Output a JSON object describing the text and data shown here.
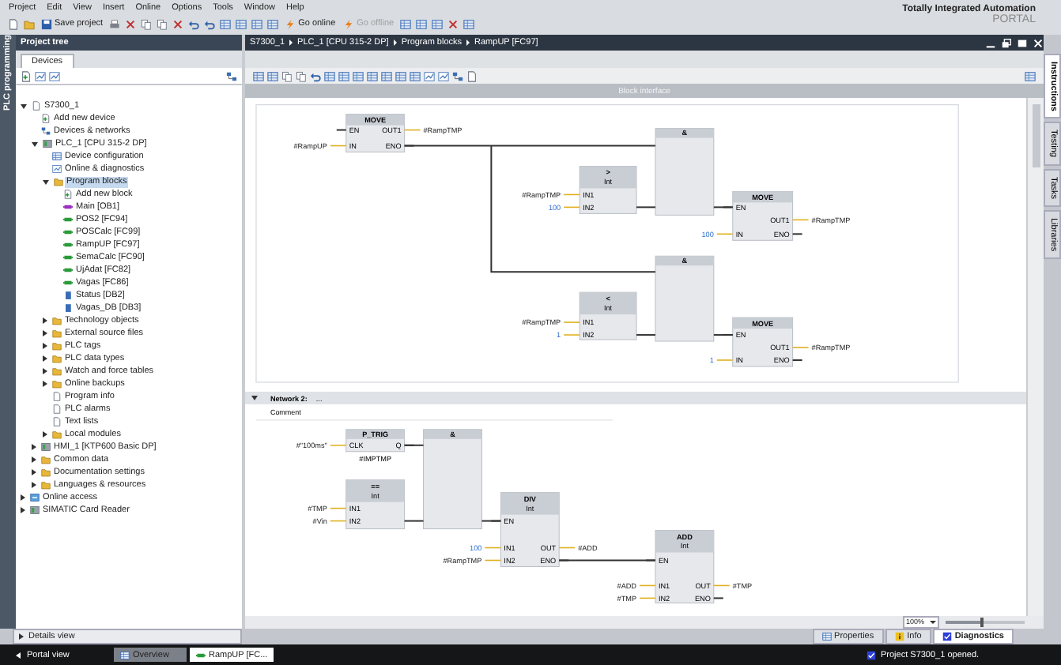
{
  "menu": [
    "Project",
    "Edit",
    "View",
    "Insert",
    "Online",
    "Options",
    "Tools",
    "Window",
    "Help"
  ],
  "brand": {
    "line_1": "Totally Integrated Automation",
    "line_2": "PORTAL"
  },
  "toolbar": {
    "save_label": "Save project",
    "online_label": "Go online",
    "offline": {
      "label": "Go offline",
      "disabled": true
    }
  },
  "left_strip": "PLC programming",
  "project_tree": {
    "title": "Project tree",
    "tabs": [
      {
        "label": "Devices",
        "selected": true
      }
    ],
    "items": [
      {
        "label": "S7300_1",
        "kind": "project",
        "selected": false,
        "expanded": true,
        "children": [
          {
            "label": "Add new device",
            "kind": "add",
            "selected": false
          },
          {
            "label": "Devices & networks",
            "kind": "network",
            "selected": false
          },
          {
            "label": "PLC_1 [CPU 315-2 DP]",
            "kind": "device",
            "selected": false,
            "expanded": true,
            "children": [
              {
                "label": "Device configuration",
                "kind": "config",
                "selected": false
              },
              {
                "label": "Online & diagnostics",
                "kind": "diag",
                "selected": false
              },
              {
                "label": "Program blocks",
                "kind": "folder",
                "selected": true,
                "expanded": true,
                "children": [
                  {
                    "label": "Add new block",
                    "kind": "add",
                    "selected": false
                  },
                  {
                    "label": "Main [OB1]",
                    "kind": "ob",
                    "selected": false
                  },
                  {
                    "label": "POS2 [FC94]",
                    "kind": "fc",
                    "selected": false
                  },
                  {
                    "label": "POSCalc [FC99]",
                    "kind": "fc",
                    "selected": false
                  },
                  {
                    "label": "RampUP [FC97]",
                    "kind": "fc",
                    "selected": false
                  },
                  {
                    "label": "SemaCalc [FC90]",
                    "kind": "fc",
                    "selected": false
                  },
                  {
                    "label": "UjAdat [FC82]",
                    "kind": "fc",
                    "selected": false
                  },
                  {
                    "label": "Vagas [FC86]",
                    "kind": "fc",
                    "selected": false
                  },
                  {
                    "label": "Status [DB2]",
                    "kind": "db",
                    "selected": false
                  },
                  {
                    "label": "Vagas_DB [DB3]",
                    "kind": "db",
                    "selected": false
                  }
                ]
              },
              {
                "label": "Technology objects",
                "kind": "folder",
                "selected": false,
                "expanded": false
              },
              {
                "label": "External source files",
                "kind": "folder",
                "selected": false,
                "expanded": false
              },
              {
                "label": "PLC tags",
                "kind": "folder",
                "selected": false,
                "expanded": false
              },
              {
                "label": "PLC data types",
                "kind": "folder",
                "selected": false,
                "expanded": false
              },
              {
                "label": "Watch and force tables",
                "kind": "folder",
                "selected": false,
                "expanded": false
              },
              {
                "label": "Online backups",
                "kind": "folder",
                "selected": false,
                "expanded": false
              },
              {
                "label": "Program info",
                "kind": "doc",
                "selected": false
              },
              {
                "label": "PLC alarms",
                "kind": "doc",
                "selected": false
              },
              {
                "label": "Text lists",
                "kind": "doc",
                "selected": false
              },
              {
                "label": "Local modules",
                "kind": "folder",
                "selected": false,
                "expanded": false
              }
            ]
          },
          {
            "label": "HMI_1 [KTP600 Basic DP]",
            "kind": "device",
            "selected": false,
            "expanded": false
          },
          {
            "label": "Common data",
            "kind": "folder",
            "selected": false,
            "expanded": false
          },
          {
            "label": "Documentation settings",
            "kind": "folder",
            "selected": false,
            "expanded": false
          },
          {
            "label": "Languages & resources",
            "kind": "folder",
            "selected": false,
            "expanded": false
          }
        ]
      },
      {
        "label": "Online access",
        "kind": "online",
        "selected": false,
        "expanded": false
      },
      {
        "label": "SIMATIC Card Reader",
        "kind": "card",
        "selected": false,
        "expanded": false
      }
    ]
  },
  "editor": {
    "breadcrumb": [
      "S7300_1",
      "PLC_1 [CPU 315-2 DP]",
      "Program blocks",
      "RampUP [FC97]"
    ],
    "interface_bar": "Block interface",
    "networks": [
      {
        "blocks": [
          {
            "title": "MOVE",
            "inputs": [
              {
                "pin": "EN"
              },
              {
                "pin": "IN",
                "operand": "#RampUP",
                "constant": false
              }
            ],
            "outputs": [
              {
                "pin": "OUT1",
                "operand": "#RampTMP",
                "constant": false
              },
              {
                "pin": "ENO"
              }
            ]
          },
          {
            "title": "&"
          },
          {
            "title": ">",
            "subtitle": "Int",
            "inputs": [
              {
                "pin": "IN1",
                "operand": "#RampTMP",
                "constant": false
              },
              {
                "pin": "IN2",
                "operand": "100",
                "constant": true
              }
            ]
          },
          {
            "title": "MOVE",
            "inputs": [
              {
                "pin": "EN"
              },
              {
                "pin": "IN",
                "operand": "100",
                "constant": true
              }
            ],
            "outputs": [
              {
                "pin": "OUT1",
                "operand": "#RampTMP",
                "constant": false
              },
              {
                "pin": "ENO"
              }
            ]
          },
          {
            "title": "&"
          },
          {
            "title": "<",
            "subtitle": "Int",
            "inputs": [
              {
                "pin": "IN1",
                "operand": "#RampTMP",
                "constant": false
              },
              {
                "pin": "IN2",
                "operand": "1",
                "constant": true
              }
            ]
          },
          {
            "title": "MOVE",
            "inputs": [
              {
                "pin": "EN"
              },
              {
                "pin": "IN",
                "operand": "1",
                "constant": true
              }
            ],
            "outputs": [
              {
                "pin": "OUT1",
                "operand": "#RampTMP",
                "constant": false
              },
              {
                "pin": "ENO"
              }
            ]
          }
        ]
      },
      {
        "label": "Network 2:",
        "title": "...",
        "comment": "Comment",
        "expanded": true,
        "blocks": [
          {
            "title": "P_TRIG",
            "inputs": [
              {
                "pin": "CLK",
                "operand": "#\"100ms\"",
                "constant": false
              }
            ],
            "outputs": [
              {
                "pin": "Q"
              }
            ],
            "bit_operand": "#IMPTMP"
          },
          {
            "title": "&"
          },
          {
            "title": "==",
            "subtitle": "Int",
            "inputs": [
              {
                "pin": "IN1",
                "operand": "#TMP",
                "constant": false
              },
              {
                "pin": "IN2",
                "operand": "#Vin",
                "constant": false
              }
            ]
          },
          {
            "title": "DIV",
            "subtitle": "Int",
            "inputs": [
              {
                "pin": "EN"
              },
              {
                "pin": "IN1",
                "operand": "100",
                "constant": true
              },
              {
                "pin": "IN2",
                "operand": "#RampTMP",
                "constant": false
              }
            ],
            "outputs": [
              {
                "pin": "OUT",
                "operand": "#ADD",
                "constant": false
              },
              {
                "pin": "ENO"
              }
            ]
          },
          {
            "title": "ADD",
            "subtitle": "Int",
            "inputs": [
              {
                "pin": "EN"
              },
              {
                "pin": "IN1",
                "operand": "#ADD",
                "constant": false
              },
              {
                "pin": "IN2",
                "operand": "#TMP",
                "constant": false
              }
            ],
            "outputs": [
              {
                "pin": "OUT",
                "operand": "#TMP",
                "constant": false
              },
              {
                "pin": "ENO"
              }
            ]
          }
        ]
      }
    ],
    "zoom": {
      "value": "100%",
      "level": 0.45
    }
  },
  "right_tabs": [
    {
      "label": "Instructions",
      "selected": true
    },
    {
      "label": "Testing",
      "selected": false
    },
    {
      "label": "Tasks",
      "selected": false
    },
    {
      "label": "Libraries",
      "selected": false
    }
  ],
  "details_view": {
    "label": "Details view",
    "expanded": false
  },
  "inspector_tabs": [
    {
      "label": "Properties",
      "selected": false
    },
    {
      "label": "Info",
      "selected": false
    },
    {
      "label": "Diagnostics",
      "selected": true
    }
  ],
  "taskbar": {
    "portal_view": "Portal view",
    "tabs": [
      {
        "label": "Overview",
        "selected": false
      },
      {
        "label": "RampUP [FC...",
        "selected": true
      }
    ],
    "status": "Project S7300_1 opened."
  }
}
